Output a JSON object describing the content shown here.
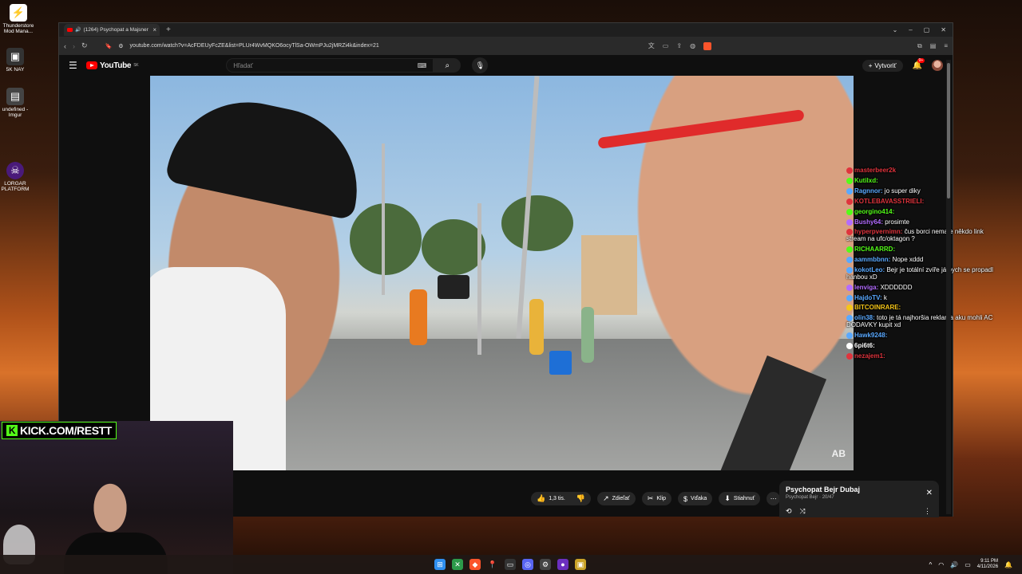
{
  "desktop": {
    "icons": [
      {
        "label": "Thunderstore Mod Mana...",
        "icon": "thunderstore-icon"
      },
      {
        "label": "5K NAY",
        "icon": "app-icon"
      },
      {
        "label": "undefined - Imgur",
        "icon": "imgur-icon"
      },
      {
        "label": "LORGAR PLATFORM",
        "icon": "lorgar-icon"
      }
    ]
  },
  "browser": {
    "tab_title": "(1264) Psychopat a Majsner ...",
    "url": "youtube.com/watch?v=AcFDEUyFcZE&list=PLUr4WvMQKO6ocyTlSa-OWmPJu2jMRZi4k&index=21",
    "colors": {
      "brave": "#fb542b"
    }
  },
  "youtube": {
    "logo": "YouTube",
    "logo_region": "SK",
    "search_placeholder": "Hľadať",
    "create_label": "Vytvoriť",
    "notification_count": "9+",
    "like_count": "1,3 tis.",
    "share_label": "Zdieľať",
    "clip_label": "Klip",
    "thanks_label": "Vďaka",
    "download_label": "Stiahnuť",
    "playlist": {
      "title": "Psychopat Bejr  Dubaj",
      "owner": "Psychopat Bejr",
      "position": "20/47"
    },
    "accent": "#ff0000"
  },
  "chat": [
    {
      "user": "masterbeer2k",
      "text": "",
      "color": "#e0343d"
    },
    {
      "user": "Kutilxd:",
      "text": "",
      "color": "#53fc18"
    },
    {
      "user": "Ragnnor:",
      "text": "jo super diky",
      "color": "#5aa9ff"
    },
    {
      "user": "KOTLEBAVASSTRIELI:",
      "text": "",
      "color": "#e0343d"
    },
    {
      "user": "georgino414:",
      "text": "",
      "color": "#53fc18"
    },
    {
      "user": "Bushy64:",
      "text": "prosimte",
      "color": "#b36cff"
    },
    {
      "user": "hyperpvernimn:",
      "text": "čus borci nemate někdo link stream na ufc/oktagon ?",
      "color": "#e0343d"
    },
    {
      "user": "RICHAARRD:",
      "text": "",
      "color": "#53fc18"
    },
    {
      "user": "aammbbnn:",
      "text": "Nope xddd",
      "color": "#5aa9ff"
    },
    {
      "user": "kokotLeo:",
      "text": "Bejr je totální zvíře já bych se propadl hanbou xD",
      "color": "#5aa9ff"
    },
    {
      "user": "lenviga:",
      "text": "XDDDDDD",
      "color": "#b36cff"
    },
    {
      "user": "HajdoTV:",
      "text": "k",
      "color": "#5aa9ff"
    },
    {
      "user": "BITCOINRARE:",
      "text": "",
      "color": "#f5c518"
    },
    {
      "user": "olin38:",
      "text": "toto je tá najhoršia reklama aku mohli AC DODAVKY kupit xd",
      "color": "#5aa9ff"
    },
    {
      "user": "Hawk9248:",
      "text": "",
      "color": "#5aa9ff"
    },
    {
      "user": "6pi6t6:",
      "text": "",
      "color": "#ffffff"
    },
    {
      "user": "nezajem1:",
      "text": "",
      "color": "#e0343d"
    }
  ],
  "stream_overlay": {
    "kick_label": "KICK.COM/RESTT",
    "kick_color": "#53fc18"
  },
  "video": {
    "watermark": "AB"
  },
  "taskbar": {
    "time": "9:11 PM",
    "date": "4/11/2026"
  }
}
